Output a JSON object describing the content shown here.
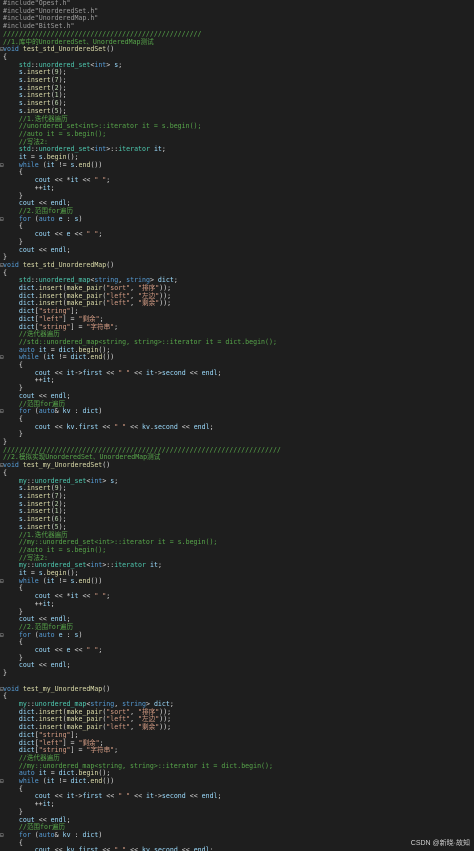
{
  "watermark": "CSDN @新晓·故知",
  "lines": [
    {
      "fold": "",
      "code": "#include\"Opesf.h\""
    },
    {
      "fold": "",
      "code": "#include\"UnorderedSet.h\""
    },
    {
      "fold": "",
      "code": "#include\"UnorderedMap.h\""
    },
    {
      "fold": "",
      "code": "#include\"BitSet.h\""
    },
    {
      "fold": "",
      "code": "//////////////////////////////////////////////////"
    },
    {
      "fold": "",
      "code": "//1.库中的UnorderedSet、UnorderedMap测试"
    },
    {
      "fold": "⊟",
      "code": "void test_std_UnorderedSet()"
    },
    {
      "fold": "",
      "code": "{"
    },
    {
      "fold": "",
      "code": "    std::unordered_set<int> s;"
    },
    {
      "fold": "",
      "code": "    s.insert(9);"
    },
    {
      "fold": "",
      "code": "    s.insert(7);"
    },
    {
      "fold": "",
      "code": "    s.insert(2);"
    },
    {
      "fold": "",
      "code": "    s.insert(1);"
    },
    {
      "fold": "",
      "code": "    s.insert(6);"
    },
    {
      "fold": "",
      "code": "    s.insert(5);"
    },
    {
      "fold": "",
      "code": "    //1.迭代器遍历"
    },
    {
      "fold": "",
      "code": "    //unordered_set<int>::iterator it = s.begin();"
    },
    {
      "fold": "",
      "code": "    //auto it = s.begin();"
    },
    {
      "fold": "",
      "code": "    //写法2:"
    },
    {
      "fold": "",
      "code": "    std::unordered_set<int>::iterator it;"
    },
    {
      "fold": "",
      "code": "    it = s.begin();"
    },
    {
      "fold": "⊟",
      "code": "    while (it != s.end())"
    },
    {
      "fold": "",
      "code": "    {"
    },
    {
      "fold": "",
      "code": "        cout << *it << \" \";"
    },
    {
      "fold": "",
      "code": "        ++it;"
    },
    {
      "fold": "",
      "code": "    }"
    },
    {
      "fold": "",
      "code": "    cout << endl;"
    },
    {
      "fold": "",
      "code": "    //2.范围for遍历"
    },
    {
      "fold": "⊟",
      "code": "    for (auto e : s)"
    },
    {
      "fold": "",
      "code": "    {"
    },
    {
      "fold": "",
      "code": "        cout << e << \" \";"
    },
    {
      "fold": "",
      "code": "    }"
    },
    {
      "fold": "",
      "code": "    cout << endl;"
    },
    {
      "fold": "",
      "code": "}"
    },
    {
      "fold": "⊟",
      "code": "void test_std_UnorderedMap()"
    },
    {
      "fold": "",
      "code": "{"
    },
    {
      "fold": "",
      "code": "    std::unordered_map<string, string> dict;"
    },
    {
      "fold": "",
      "code": "    dict.insert(make_pair(\"sort\", \"排序\"));"
    },
    {
      "fold": "",
      "code": "    dict.insert(make_pair(\"left\", \"左边\"));"
    },
    {
      "fold": "",
      "code": "    dict.insert(make_pair(\"left\", \"剩余\"));"
    },
    {
      "fold": "",
      "code": "    dict[\"string\"];"
    },
    {
      "fold": "",
      "code": "    dict[\"left\"] = \"剩余\";"
    },
    {
      "fold": "",
      "code": "    dict[\"string\"] = \"字符串\";"
    },
    {
      "fold": "",
      "code": "    //迭代器遍历"
    },
    {
      "fold": "",
      "code": "    //std::unordered_map<string, string>::iterator it = dict.begin();"
    },
    {
      "fold": "",
      "code": "    auto it = dict.begin();"
    },
    {
      "fold": "⊟",
      "code": "    while (it != dict.end())"
    },
    {
      "fold": "",
      "code": "    {"
    },
    {
      "fold": "",
      "code": "        cout << it->first << \" \" << it->second << endl;"
    },
    {
      "fold": "",
      "code": "        ++it;"
    },
    {
      "fold": "",
      "code": "    }"
    },
    {
      "fold": "",
      "code": "    cout << endl;"
    },
    {
      "fold": "",
      "code": "    //范围for遍历"
    },
    {
      "fold": "⊟",
      "code": "    for (auto& kv : dict)"
    },
    {
      "fold": "",
      "code": "    {"
    },
    {
      "fold": "",
      "code": "        cout << kv.first << \" \" << kv.second << endl;"
    },
    {
      "fold": "",
      "code": "    }"
    },
    {
      "fold": "",
      "code": "}"
    },
    {
      "fold": "",
      "code": "//////////////////////////////////////////////////////////////////////"
    },
    {
      "fold": "",
      "code": "//2.模拟实现UnorderedSet、UnorderedMap测试"
    },
    {
      "fold": "⊟",
      "code": "void test_my_UnorderedSet()"
    },
    {
      "fold": "",
      "code": "{"
    },
    {
      "fold": "",
      "code": "    my::unordered_set<int> s;"
    },
    {
      "fold": "",
      "code": "    s.insert(9);"
    },
    {
      "fold": "",
      "code": "    s.insert(7);"
    },
    {
      "fold": "",
      "code": "    s.insert(2);"
    },
    {
      "fold": "",
      "code": "    s.insert(1);"
    },
    {
      "fold": "",
      "code": "    s.insert(6);"
    },
    {
      "fold": "",
      "code": "    s.insert(5);"
    },
    {
      "fold": "",
      "code": "    //1.迭代器遍历"
    },
    {
      "fold": "",
      "code": "    //my::unordered_set<int>::iterator it = s.begin();"
    },
    {
      "fold": "",
      "code": "    //auto it = s.begin();"
    },
    {
      "fold": "",
      "code": "    //写法2:"
    },
    {
      "fold": "",
      "code": "    my::unordered_set<int>::iterator it;"
    },
    {
      "fold": "",
      "code": "    it = s.begin();"
    },
    {
      "fold": "⊟",
      "code": "    while (it != s.end())"
    },
    {
      "fold": "",
      "code": "    {"
    },
    {
      "fold": "",
      "code": "        cout << *it << \" \";"
    },
    {
      "fold": "",
      "code": "        ++it;"
    },
    {
      "fold": "",
      "code": "    }"
    },
    {
      "fold": "",
      "code": "    cout << endl;"
    },
    {
      "fold": "",
      "code": "    //2.范围for遍历"
    },
    {
      "fold": "⊟",
      "code": "    for (auto e : s)"
    },
    {
      "fold": "",
      "code": "    {"
    },
    {
      "fold": "",
      "code": "        cout << e << \" \";"
    },
    {
      "fold": "",
      "code": "    }"
    },
    {
      "fold": "",
      "code": "    cout << endl;"
    },
    {
      "fold": "",
      "code": "}"
    },
    {
      "fold": "",
      "code": ""
    },
    {
      "fold": "⊟",
      "code": "void test_my_UnorderedMap()"
    },
    {
      "fold": "",
      "code": "{"
    },
    {
      "fold": "",
      "code": "    my::unordered_map<string, string> dict;"
    },
    {
      "fold": "",
      "code": "    dict.insert(make_pair(\"sort\", \"排序\"));"
    },
    {
      "fold": "",
      "code": "    dict.insert(make_pair(\"left\", \"左边\"));"
    },
    {
      "fold": "",
      "code": "    dict.insert(make_pair(\"left\", \"剩余\"));"
    },
    {
      "fold": "",
      "code": "    dict[\"string\"];"
    },
    {
      "fold": "",
      "code": "    dict[\"left\"] = \"剩余\";"
    },
    {
      "fold": "",
      "code": "    dict[\"string\"] = \"字符串\";"
    },
    {
      "fold": "",
      "code": "    //迭代器遍历"
    },
    {
      "fold": "",
      "code": "    //my::unordered_map<string, string>::iterator it = dict.begin();"
    },
    {
      "fold": "",
      "code": "    auto it = dict.begin();"
    },
    {
      "fold": "⊟",
      "code": "    while (it != dict.end())"
    },
    {
      "fold": "",
      "code": "    {"
    },
    {
      "fold": "",
      "code": "        cout << it->first << \" \" << it->second << endl;"
    },
    {
      "fold": "",
      "code": "        ++it;"
    },
    {
      "fold": "",
      "code": "    }"
    },
    {
      "fold": "",
      "code": "    cout << endl;"
    },
    {
      "fold": "",
      "code": "    //范围for遍历"
    },
    {
      "fold": "⊟",
      "code": "    for (auto& kv : dict)"
    },
    {
      "fold": "",
      "code": "    {"
    },
    {
      "fold": "",
      "code": "        cout << kv.first << \" \" << kv.second << endl;"
    },
    {
      "fold": "",
      "code": "    }"
    }
  ]
}
